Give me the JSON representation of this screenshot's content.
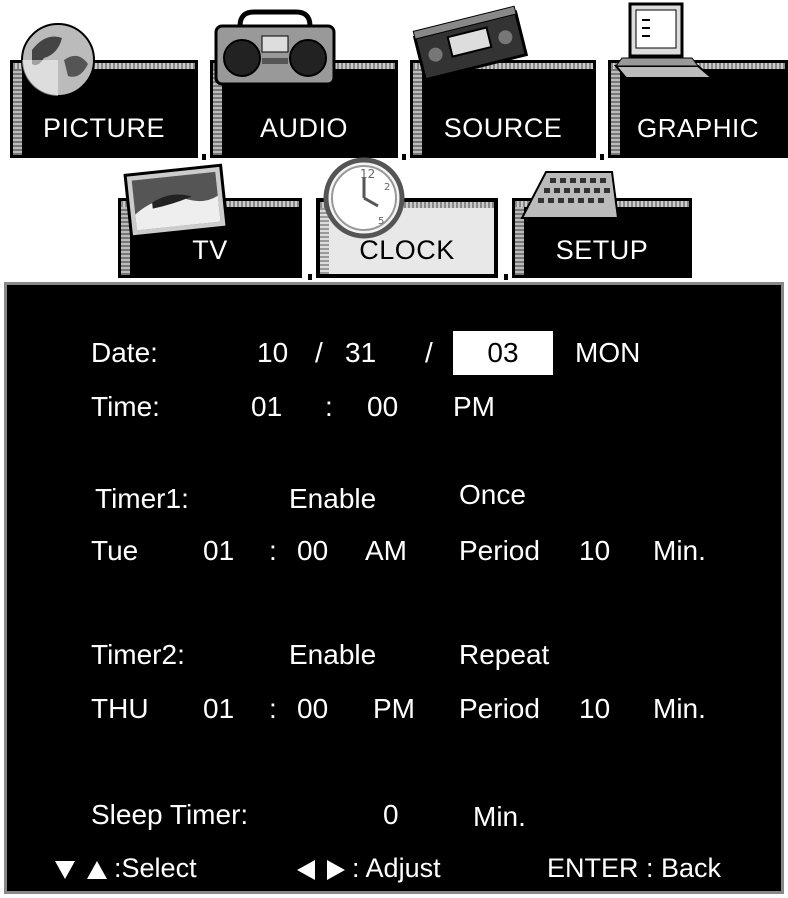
{
  "menu": {
    "row1": [
      {
        "label": "PICTURE",
        "icon": "globe-icon"
      },
      {
        "label": "AUDIO",
        "icon": "boombox-icon"
      },
      {
        "label": "SOURCE",
        "icon": "vcr-tape-icon"
      },
      {
        "label": "GRAPHIC",
        "icon": "computer-icon"
      }
    ],
    "row2": [
      {
        "label": "TV",
        "icon": "tv-screen-icon"
      },
      {
        "label": "CLOCK",
        "icon": "clock-icon",
        "active": true
      },
      {
        "label": "SETUP",
        "icon": "keyboard-icon"
      }
    ]
  },
  "clock": {
    "date": {
      "label": "Date:",
      "month": "10",
      "sep1": "/",
      "day": "31",
      "sep2": "/",
      "year": "03",
      "weekday": "MON"
    },
    "time": {
      "label": "Time:",
      "hour": "01",
      "sep": ":",
      "minute": "00",
      "ampm": "PM"
    },
    "timer1": {
      "label": "Timer1:",
      "state": "Enable",
      "mode": "Once",
      "day": "Tue",
      "hour": "01",
      "sep": ":",
      "minute": "00",
      "ampm": "AM",
      "period_label": "Period",
      "period": "10",
      "unit": "Min."
    },
    "timer2": {
      "label": "Timer2:",
      "state": "Enable",
      "mode": "Repeat",
      "day": "THU",
      "hour": "01",
      "sep": ":",
      "minute": "00",
      "ampm": "PM",
      "period_label": "Period",
      "period": "10",
      "unit": "Min."
    },
    "sleep": {
      "label": "Sleep Timer:",
      "value": "0",
      "unit": "Min."
    }
  },
  "footer": {
    "select": ":Select",
    "adjust": ": Adjust",
    "back": "ENTER : Back"
  },
  "colors": {
    "background": "#000000",
    "text": "#ffffff",
    "highlight": "#ffffff",
    "active_tab": "#e8e8e8"
  }
}
